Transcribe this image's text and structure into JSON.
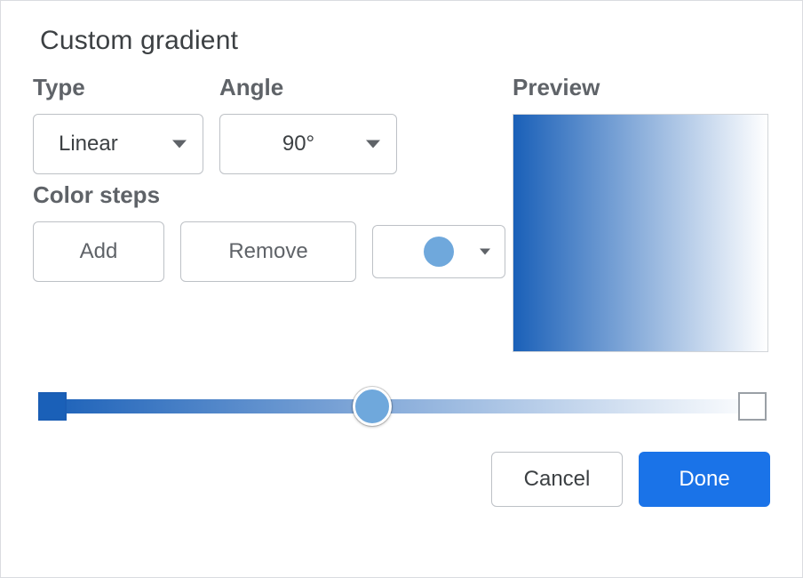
{
  "title": "Custom gradient",
  "type": {
    "label": "Type",
    "value": "Linear"
  },
  "angle": {
    "label": "Angle",
    "value": "90°"
  },
  "colorSteps": {
    "label": "Color steps",
    "addLabel": "Add",
    "removeLabel": "Remove",
    "selectedColor": "#6fa8dc"
  },
  "preview": {
    "label": "Preview"
  },
  "gradient": {
    "startColor": "#1a60b8",
    "endColor": "#ffffff",
    "handleColor": "#6fa8dc",
    "handlePositionPercent": 46
  },
  "footer": {
    "cancel": "Cancel",
    "done": "Done"
  }
}
